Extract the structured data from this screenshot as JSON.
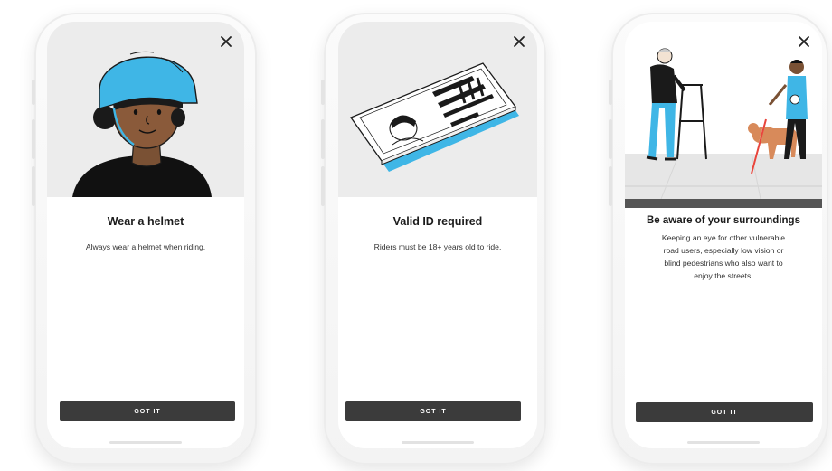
{
  "cards": [
    {
      "title": "Wear a helmet",
      "description": "Always wear a helmet when riding.",
      "button_label": "GOT IT",
      "close_icon": "close-icon",
      "illustration": "person-wearing-blue-helmet"
    },
    {
      "title": "Valid ID required",
      "description": "Riders must be 18+ years old to ride.",
      "button_label": "GOT IT",
      "close_icon": "close-icon",
      "illustration": "id-card"
    },
    {
      "title": "Be aware of your surroundings",
      "description": "Keeping an eye for other vulnerable road users, especially low vision or blind pedestrians who also want to enjoy the streets.",
      "button_label": "GOT IT",
      "close_icon": "close-icon",
      "illustration": "pedestrian-with-walker-and-guide-dog"
    }
  ],
  "colors": {
    "accent_blue": "#3fb6e6",
    "button_bg": "#3b3b3b",
    "illustration_bg": "#ececec"
  }
}
